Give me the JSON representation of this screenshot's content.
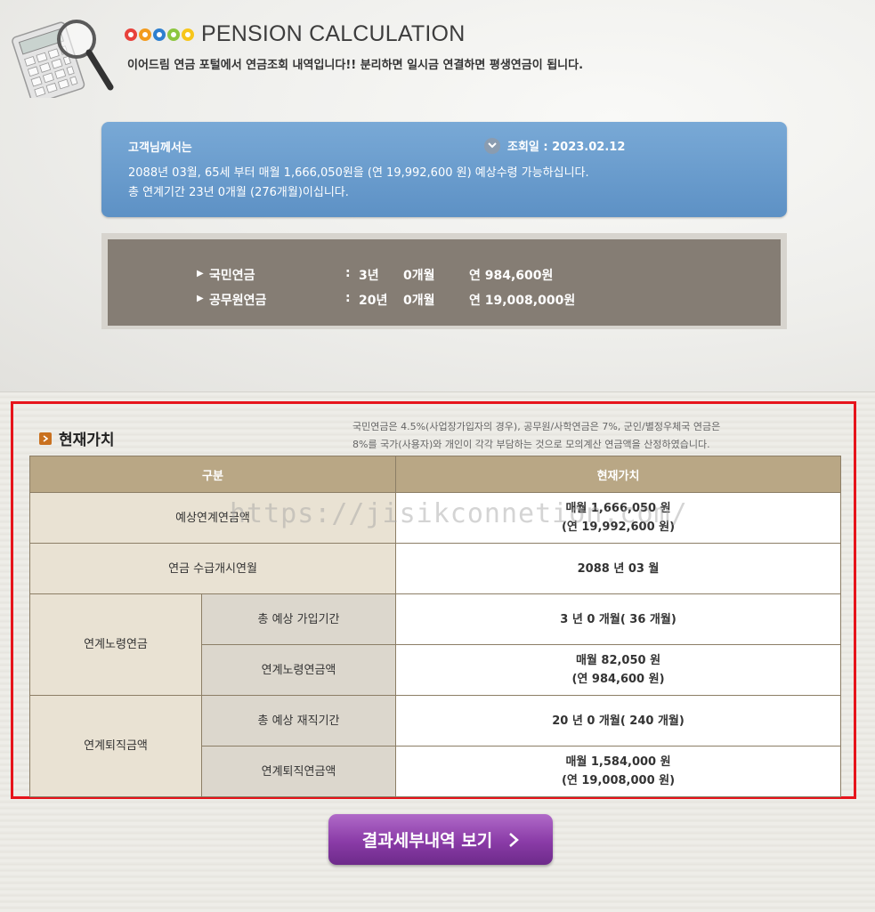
{
  "header": {
    "title": "PENSION CALCULATION",
    "subtitle": "이어드림 연금 포털에서 연금조회 내역입니다!!  분리하면 일시금 연결하면 평생연금이 됩니다.",
    "logo_colors": [
      "#e8413b",
      "#f39b1d",
      "#2e7fcf",
      "#8cc63f",
      "#f7c61b"
    ]
  },
  "summary": {
    "greeting": "고객님께서는",
    "date_label": "조회일 : 2023.02.12",
    "line1": "2088년 03월, 65세 부터 매월 1,666,050원을 (연 19,992,600 원) 예상수령 가능하십니다.",
    "line2": "총 연계기간 23년 0개월 (276개월)이십니다."
  },
  "pensions": [
    {
      "name": "국민연금",
      "colon": ":",
      "years": "3년",
      "months": "0개월",
      "annual": "연 984,600원"
    },
    {
      "name": "공무원연금",
      "colon": ":",
      "years": "20년",
      "months": "0개월",
      "annual": "연 19,008,000원"
    }
  ],
  "section": {
    "title": "현재가치",
    "note_line1": "국민연금은 4.5%(사업장가입자의 경우), 공무원/사학연금은 7%, 군인/별정우체국 연금은",
    "note_line2": "8%를 국가(사용자)와 개인이 각각 부담하는 것으로 모의계산 연금액을 산정하였습니다."
  },
  "table": {
    "header_category": "구분",
    "header_value": "현재가치",
    "row1_label": "예상연계연금액",
    "row1_value_line1": "매월  1,666,050 원",
    "row1_value_line2": "(연  19,992,600 원)",
    "row2_label": "연금 수급개시연월",
    "row2_value": "2088 년  03 월",
    "group1_label": "연계노령연금",
    "group1_sub1_label": "총 예상 가입기간",
    "group1_sub1_value": "3 년  0 개월( 36 개월)",
    "group1_sub2_label": "연계노령연금액",
    "group1_sub2_value_line1": "매월  82,050  원",
    "group1_sub2_value_line2": "(연  984,600 원)",
    "group2_label": "연계퇴직금액",
    "group2_sub1_label": "총 예상 재직기간",
    "group2_sub1_value": "20 년  0 개월( 240 개월)",
    "group2_sub2_label": "연계퇴직연금액",
    "group2_sub2_value_line1": "매월  1,584,000  원",
    "group2_sub2_value_line2": "(연  19,008,000 원)"
  },
  "watermark": "https://jisikconnetion.com/",
  "button": {
    "label": "결과세부내역 보기"
  },
  "colors": {
    "accent_blue": "#6a9dcd",
    "panel_gray": "#857d74",
    "table_header": "#b9a785",
    "highlight_red": "#e6141b",
    "button_purple": "#8a3ba7"
  }
}
